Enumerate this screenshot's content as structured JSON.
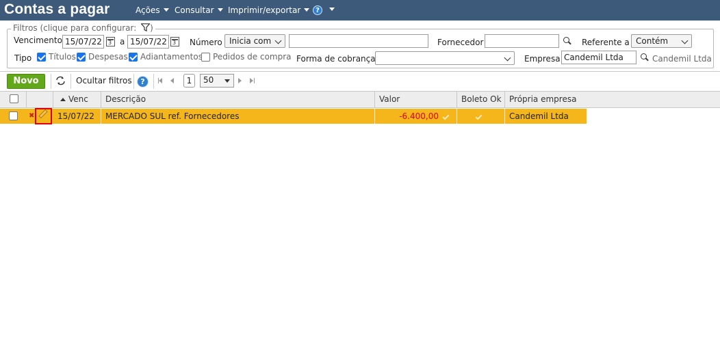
{
  "header": {
    "title": "Contas a pagar",
    "menu": [
      {
        "label": "Ações"
      },
      {
        "label": "Consultar"
      },
      {
        "label": "Imprimir/exportar"
      }
    ],
    "help_symbol": "?"
  },
  "filters": {
    "legend": "Filtros (clique para configurar:",
    "legend_close": ")",
    "vencimento_label": "Vencimento",
    "vencimento_from": "15/07/22",
    "a_label": "a",
    "vencimento_to": "15/07/22",
    "numero_label": "Número",
    "numero_mode": "Inicia com",
    "numero_value": "",
    "fornecedor_label": "Fornecedor",
    "fornecedor_value": "",
    "referente_label": "Referente a",
    "referente_mode": "Contém",
    "tipo_label": "Tipo",
    "tipos": [
      {
        "label": "Títulos",
        "checked": true
      },
      {
        "label": "Despesas",
        "checked": true
      },
      {
        "label": "Adiantamentos",
        "checked": true
      },
      {
        "label": "Pedidos de compra",
        "checked": false
      }
    ],
    "forma_cobranca_label": "Forma de cobrança",
    "forma_cobranca_value": "",
    "empresa_label": "Empresa",
    "empresa_value": "Candemil Ltda",
    "empresa_display": "Candemil Ltda"
  },
  "toolbar": {
    "novo_label": "Novo",
    "ocultar_label": "Ocultar filtros",
    "help_symbol": "?",
    "page": "1",
    "per_page": "50"
  },
  "grid": {
    "columns": {
      "venc": "Venc",
      "descricao": "Descrição",
      "valor": "Valor",
      "boleto": "Boleto Ok",
      "empresa": "Própria empresa"
    },
    "rows": [
      {
        "venc": "15/07/22",
        "descricao": "MERCADO SUL ref. Fornecedores",
        "valor": "-6.400,00",
        "empresa": "Candemil Ltda"
      }
    ]
  },
  "colors": {
    "header_bg": "#3d5a7a",
    "selected_row": "#f4b61a",
    "novo_button": "#63a81a",
    "negative_value": "#e0000e"
  }
}
